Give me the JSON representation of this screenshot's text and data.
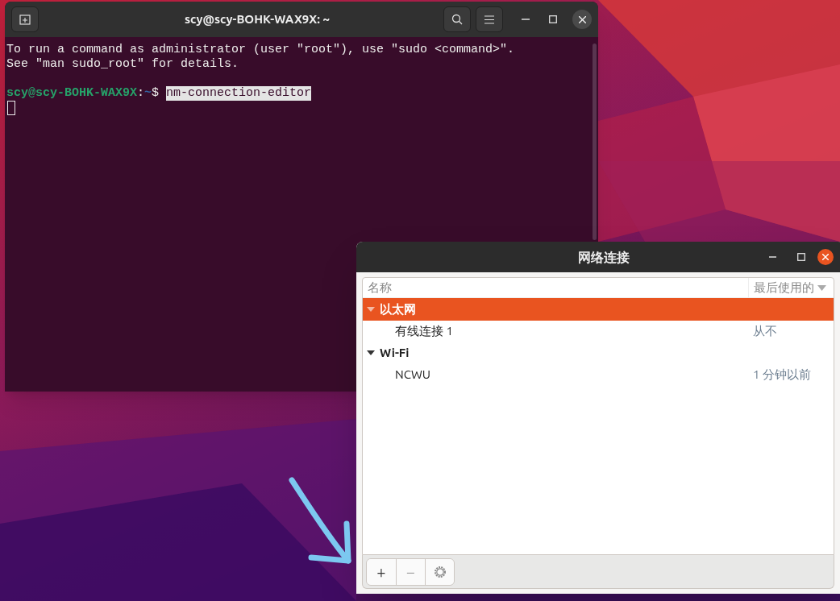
{
  "terminal": {
    "title": "scy@scy-BOHK-WAX9X: ~",
    "lines": [
      "To run a command as administrator (user \"root\"), use \"sudo <command>\".",
      "See \"man sudo_root\" for details."
    ],
    "prompt": {
      "user_host": "scy@scy-BOHK-WAX9X",
      "separator": ":",
      "path": "~",
      "symbol": "$",
      "command": "nm-connection-editor",
      "command_selected": true
    }
  },
  "dialog": {
    "title": "网络连接",
    "columns": [
      {
        "label": "名称"
      },
      {
        "label": "最后使用的",
        "sorted": true
      }
    ],
    "groups": [
      {
        "name": "以太网",
        "expanded": true,
        "selected": true,
        "children": [
          {
            "name": "有线连接 1",
            "last_used": "从不"
          }
        ]
      },
      {
        "name": "Wi-Fi",
        "expanded": true,
        "selected": false,
        "children": [
          {
            "name": "NCWU",
            "last_used": "1 分钟以前"
          }
        ]
      }
    ],
    "buttons": [
      {
        "kind": "add",
        "label": "+",
        "disabled": false
      },
      {
        "kind": "remove",
        "label": "−",
        "disabled": true
      },
      {
        "kind": "settings",
        "disabled": true
      }
    ]
  }
}
